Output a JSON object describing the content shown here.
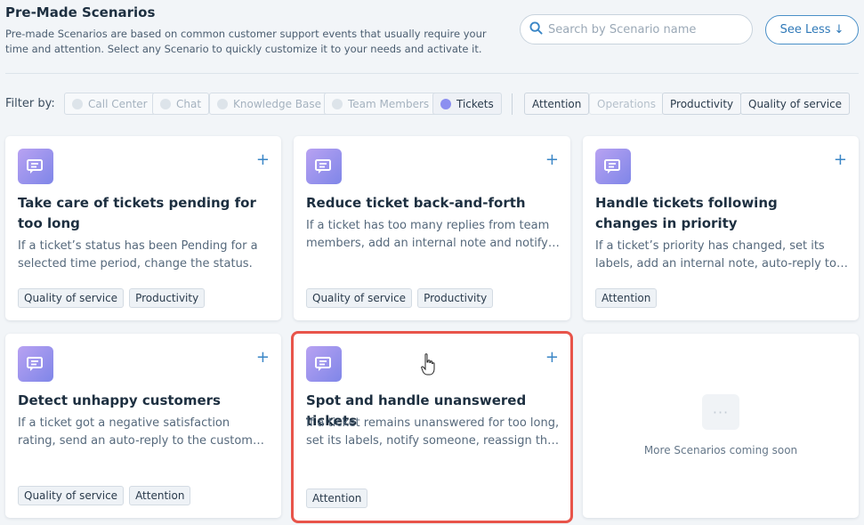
{
  "header": {
    "title": "Pre-Made Scenarios",
    "description": "Pre-made Scenarios are based on common customer support events that usually require your time and attention. Select any Scenario to quickly customize it to your needs and activate it."
  },
  "search": {
    "placeholder": "Search by Scenario name",
    "value": ""
  },
  "see_less": {
    "label": "See Less",
    "icon": "arrow-down-icon"
  },
  "filters": {
    "label": "Filter by:",
    "categories": [
      {
        "label": "Call Center",
        "active": false
      },
      {
        "label": "Chat",
        "active": false
      },
      {
        "label": "Knowledge Base",
        "active": false
      },
      {
        "label": "Team Members",
        "active": false
      },
      {
        "label": "Tickets",
        "active": true
      }
    ],
    "tags": [
      {
        "label": "Attention",
        "enabled": true
      },
      {
        "label": "Operations",
        "enabled": false
      },
      {
        "label": "Productivity",
        "enabled": true
      },
      {
        "label": "Quality of service",
        "enabled": true
      }
    ]
  },
  "cards": [
    {
      "title": "Take care of tickets pending for too long",
      "description": "If a ticket’s status has been Pending for a selected time period, change the status.",
      "tags": [
        "Quality of service",
        "Productivity"
      ],
      "icon": "chat-ticket-icon"
    },
    {
      "title": "Reduce ticket back-and-forth",
      "description": "If a ticket has too many replies from team members, add an internal note and notify someone.",
      "tags": [
        "Quality of service",
        "Productivity"
      ],
      "icon": "chat-ticket-icon"
    },
    {
      "title": "Handle tickets following changes in priority",
      "description": "If a ticket’s priority has changed, set its labels, add an internal note, auto-reply to the customer.",
      "tags": [
        "Attention"
      ],
      "icon": "chat-ticket-icon"
    },
    {
      "title": "Detect unhappy customers",
      "description": "If a ticket got a negative satisfaction rating, send an auto-reply to the customer and notify someone.",
      "tags": [
        "Quality of service",
        "Attention"
      ],
      "icon": "chat-ticket-icon"
    },
    {
      "title": "Spot and handle unanswered tickets",
      "description": "If a ticket remains unanswered for too long, set its labels, notify someone, reassign the ticket.",
      "tags": [
        "Attention"
      ],
      "icon": "chat-ticket-icon"
    }
  ],
  "coming_soon": {
    "label": "More Scenarios coming soon",
    "icon": "more-dots-icon"
  },
  "colors": {
    "accent": "#3a86c6",
    "active_dot": "#8c8ff0",
    "highlight": "#e8544a"
  }
}
